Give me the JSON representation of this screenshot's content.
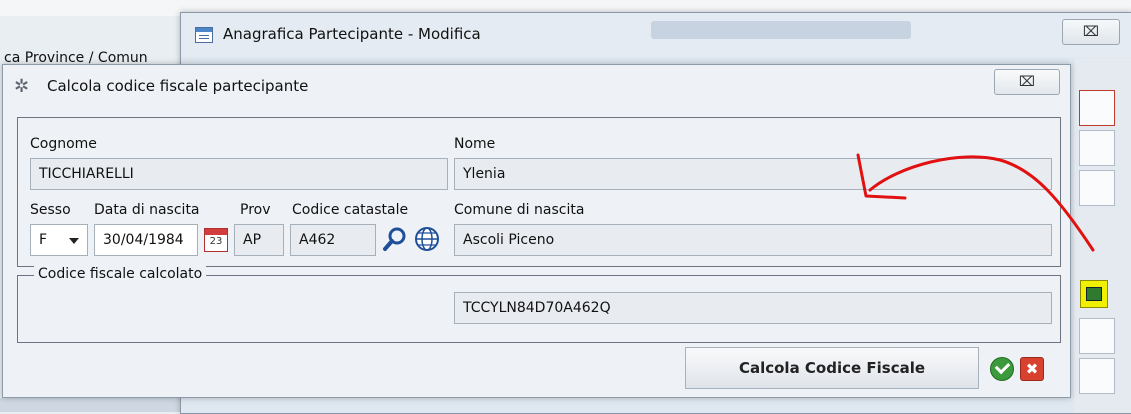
{
  "background": {
    "breadcrumb": "ca Province / Comun"
  },
  "outer_window": {
    "title": "Anagrafica Partecipante - Modifica",
    "close_glyph": "⌧"
  },
  "dialog": {
    "title": "Calcola codice fiscale partecipante",
    "close_glyph": "⌧",
    "labels": {
      "cognome": "Cognome",
      "nome": "Nome",
      "sesso": "Sesso",
      "data_nascita": "Data di nascita",
      "prov": "Prov",
      "codice_catastale": "Codice catastale",
      "comune_nascita": "Comune di nascita"
    },
    "values": {
      "cognome": "TICCHIARELLI",
      "nome": "Ylenia",
      "sesso": "F",
      "data_nascita": "30/04/1984",
      "prov": "AP",
      "codice_catastale": "A462",
      "comune_nascita": "Ascoli Piceno"
    },
    "calendar_day": "23",
    "result_group": {
      "legend": "Codice fiscale calcolato",
      "value": "TCCYLN84D70A462Q"
    },
    "actions": {
      "calculate_label": "Calcola Codice Fiscale",
      "cancel_glyph": "✖"
    }
  },
  "colors": {
    "annotation": "#e11111",
    "ok": "#3c9a3c",
    "cancel": "#d9412f",
    "highlight": "#f0f000"
  }
}
